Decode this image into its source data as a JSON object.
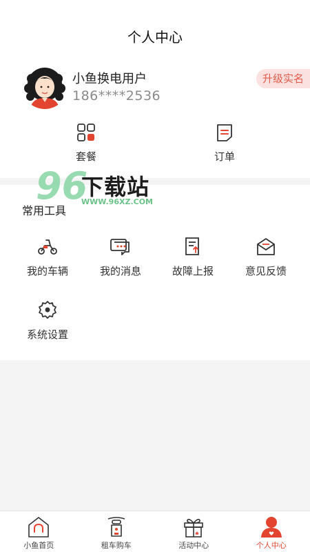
{
  "header": {
    "title": "个人中心"
  },
  "profile": {
    "username": "小鱼换电用户",
    "phone": "186****2536",
    "verify_label": "升级实名"
  },
  "quick_actions": [
    {
      "label": "套餐",
      "icon": "package-grid-icon"
    },
    {
      "label": "订单",
      "icon": "order-list-icon"
    }
  ],
  "tools": {
    "title": "常用工具",
    "items": [
      {
        "label": "我的车辆",
        "icon": "scooter-icon"
      },
      {
        "label": "我的消息",
        "icon": "message-icon"
      },
      {
        "label": "故障上报",
        "icon": "report-icon"
      },
      {
        "label": "意见反馈",
        "icon": "feedback-mail-icon"
      },
      {
        "label": "系统设置",
        "icon": "gear-icon"
      }
    ]
  },
  "watermark": {
    "num": "96",
    "text": "下载站",
    "url": "WWW.96XZ.COM"
  },
  "tabbar": {
    "items": [
      {
        "label": "小鱼首页",
        "icon": "home-icon"
      },
      {
        "label": "租车购车",
        "icon": "rent-scooter-icon"
      },
      {
        "label": "活动中心",
        "icon": "gift-icon"
      },
      {
        "label": "个人中心",
        "icon": "person-icon",
        "active": true
      }
    ]
  },
  "colors": {
    "accent": "#e2442f",
    "badge_bg": "#fbe2e0",
    "badge_text": "#e35a4a"
  }
}
